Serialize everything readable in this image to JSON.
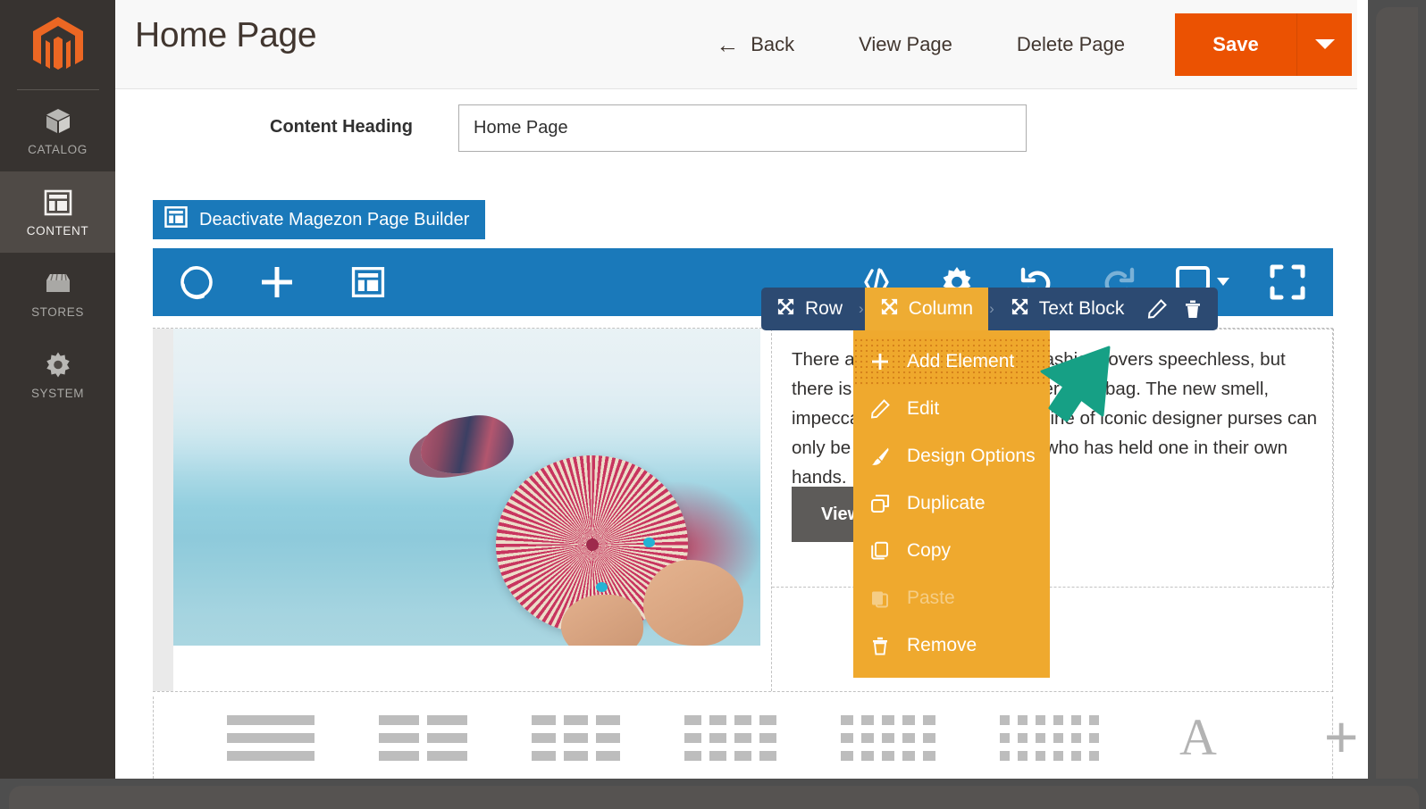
{
  "sidebar": {
    "logo_name": "magento-logo",
    "items": [
      {
        "label": "CATALOG",
        "icon": "box-icon",
        "active": false
      },
      {
        "label": "CONTENT",
        "icon": "layout-icon",
        "active": true
      },
      {
        "label": "STORES",
        "icon": "store-icon",
        "active": false
      },
      {
        "label": "SYSTEM",
        "icon": "gear-icon",
        "active": false
      }
    ]
  },
  "header": {
    "title": "Home Page",
    "back_label": "Back",
    "back_icon": "arrow-left-icon",
    "view_page_label": "View Page",
    "delete_page_label": "Delete Page",
    "save_label": "Save",
    "save_caret_icon": "caret-down-icon",
    "accent_color": "#eb5202"
  },
  "form": {
    "content_heading_label": "Content Heading",
    "content_heading_value": "Home Page",
    "content_heading_placeholder": "Content Heading"
  },
  "deactivate_button": {
    "label": "Deactivate Magezon Page Builder",
    "icon": "layout-icon",
    "color": "#1a79ba"
  },
  "builder_toolbar": {
    "color": "#1a79ba",
    "left_icons": [
      {
        "name": "magezon-logo-icon"
      },
      {
        "name": "plus-icon"
      },
      {
        "name": "layout-icon"
      }
    ],
    "right_icons": [
      {
        "name": "code-icon",
        "disabled": false
      },
      {
        "name": "gear-icon",
        "disabled": false
      },
      {
        "name": "undo-icon",
        "disabled": false
      },
      {
        "name": "redo-icon",
        "disabled": true
      },
      {
        "name": "monitor-icon",
        "disabled": false
      },
      {
        "name": "fullscreen-icon",
        "disabled": false
      }
    ]
  },
  "breadcrumb": {
    "background": "#2c4a72",
    "selected_color": "#eeac33",
    "items": [
      {
        "label": "Row",
        "icon": "move-icon",
        "selected": false
      },
      {
        "label": "Column",
        "icon": "move-icon",
        "selected": true
      },
      {
        "label": "Text Block",
        "icon": "move-icon",
        "selected": false
      }
    ],
    "separator": "›",
    "actions": [
      {
        "name": "pencil-icon"
      },
      {
        "name": "trash-icon"
      }
    ]
  },
  "context_menu": {
    "background": "#efa92e",
    "items": [
      {
        "label": "Add Element",
        "icon": "plus-icon",
        "highlighted": true,
        "disabled": false
      },
      {
        "label": "Edit",
        "icon": "pencil-icon",
        "highlighted": false,
        "disabled": false
      },
      {
        "label": "Design Options",
        "icon": "brush-icon",
        "highlighted": false,
        "disabled": false
      },
      {
        "label": "Duplicate",
        "icon": "duplicate-icon",
        "highlighted": false,
        "disabled": false
      },
      {
        "label": "Copy",
        "icon": "copy-icon",
        "highlighted": false,
        "disabled": false
      },
      {
        "label": "Paste",
        "icon": "paste-icon",
        "highlighted": false,
        "disabled": true
      },
      {
        "label": "Remove",
        "icon": "trash-icon",
        "highlighted": false,
        "disabled": false
      }
    ]
  },
  "stage": {
    "image_alt": "woman holding a round pink rattan handbag at the beach",
    "text_block": "There are few bags that leave fashion-lovers speechless, but there is one: a brand new leather handbag. The new smell, impeccable stitching and clean line of iconic designer purses can only be described by someone who has held one in their own hands.",
    "cta_label": "View details"
  },
  "element_tray": {
    "layout_icons": [
      {
        "name": "one-column-icon",
        "columns": 1
      },
      {
        "name": "two-column-icon",
        "columns": 2
      },
      {
        "name": "three-column-icon",
        "columns": 3
      },
      {
        "name": "four-column-icon",
        "columns": 4
      },
      {
        "name": "five-column-icon",
        "columns": 5
      },
      {
        "name": "six-column-icon",
        "columns": 6
      }
    ],
    "text_glyph": "A",
    "add_glyph": "+"
  },
  "cursor": {
    "name": "mouse-pointer-arrow",
    "color": "#16a085"
  }
}
